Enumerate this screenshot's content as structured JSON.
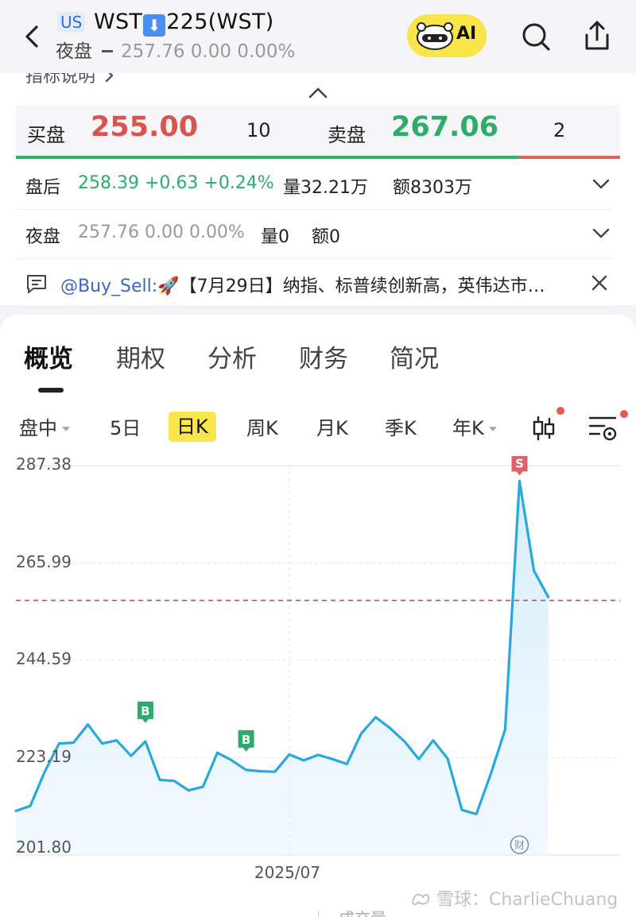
{
  "header": {
    "market": "US",
    "ticker_prefix": "WST",
    "ticker_arrow": "⬇",
    "ticker_suffix": "225(WST)",
    "session_label": "夜盘",
    "session_quote": "257.76 0.00 0.00%",
    "ai_label": "AI"
  },
  "panel": {
    "indicator_label": "指标说明",
    "bid_label": "买盘",
    "bid_price": "255.00",
    "bid_qty": "10",
    "ask_label": "卖盘",
    "ask_price": "267.06",
    "ask_qty": "2",
    "bid_ratio": 0.833,
    "after_hours": {
      "label": "盘后",
      "quote": "258.39 +0.63 +0.24%",
      "volume": "量32.21万",
      "amount": "额8303万"
    },
    "night": {
      "label": "夜盘",
      "quote": "257.76 0.00 0.00%",
      "volume": "量0",
      "amount": "额0"
    },
    "news": {
      "mention": "@Buy_Sell:",
      "emoji": "🚀",
      "text": "【7月29日】纳指、标普续创新高，英伟达市…"
    }
  },
  "tabs": [
    "概览",
    "期权",
    "分析",
    "财务",
    "简况"
  ],
  "periods": [
    "盘中",
    "5日",
    "日K",
    "周K",
    "月K",
    "季K",
    "年K"
  ],
  "selected_period": "日K",
  "colors": {
    "up": "#2dad6a",
    "down": "#d9534f",
    "line": "#29a8e0",
    "highlight": "#fbe54d"
  },
  "chart_data": {
    "type": "line",
    "y_ticks": [
      "287.38",
      "265.99",
      "244.59",
      "223.19",
      "201.80"
    ],
    "ylim": [
      201.8,
      287.38
    ],
    "x_tick_label": "2025/07",
    "x_tick_index": 19,
    "reference_price": 257.76,
    "values": [
      211.5,
      212.6,
      220.1,
      226.3,
      226.5,
      230.5,
      226.3,
      227.0,
      223.6,
      226.8,
      218.3,
      218.1,
      216.0,
      216.8,
      224.3,
      222.6,
      220.5,
      220.2,
      220.1,
      223.9,
      222.6,
      223.8,
      222.9,
      221.8,
      228.5,
      232.1,
      229.7,
      226.8,
      222.9,
      227.0,
      223.0,
      211.7,
      210.8,
      219.6,
      229.4,
      284.0,
      264.3,
      258.5
    ],
    "markers": [
      {
        "label": "B",
        "index": 9,
        "type": "buy"
      },
      {
        "label": "B",
        "index": 16,
        "type": "buy"
      },
      {
        "label": "S",
        "index": 35,
        "type": "sell"
      }
    ],
    "event_marker": {
      "label": "财",
      "index": 35
    }
  },
  "watermark": "雪球：CharlieChuang",
  "partial_text": "成交量"
}
